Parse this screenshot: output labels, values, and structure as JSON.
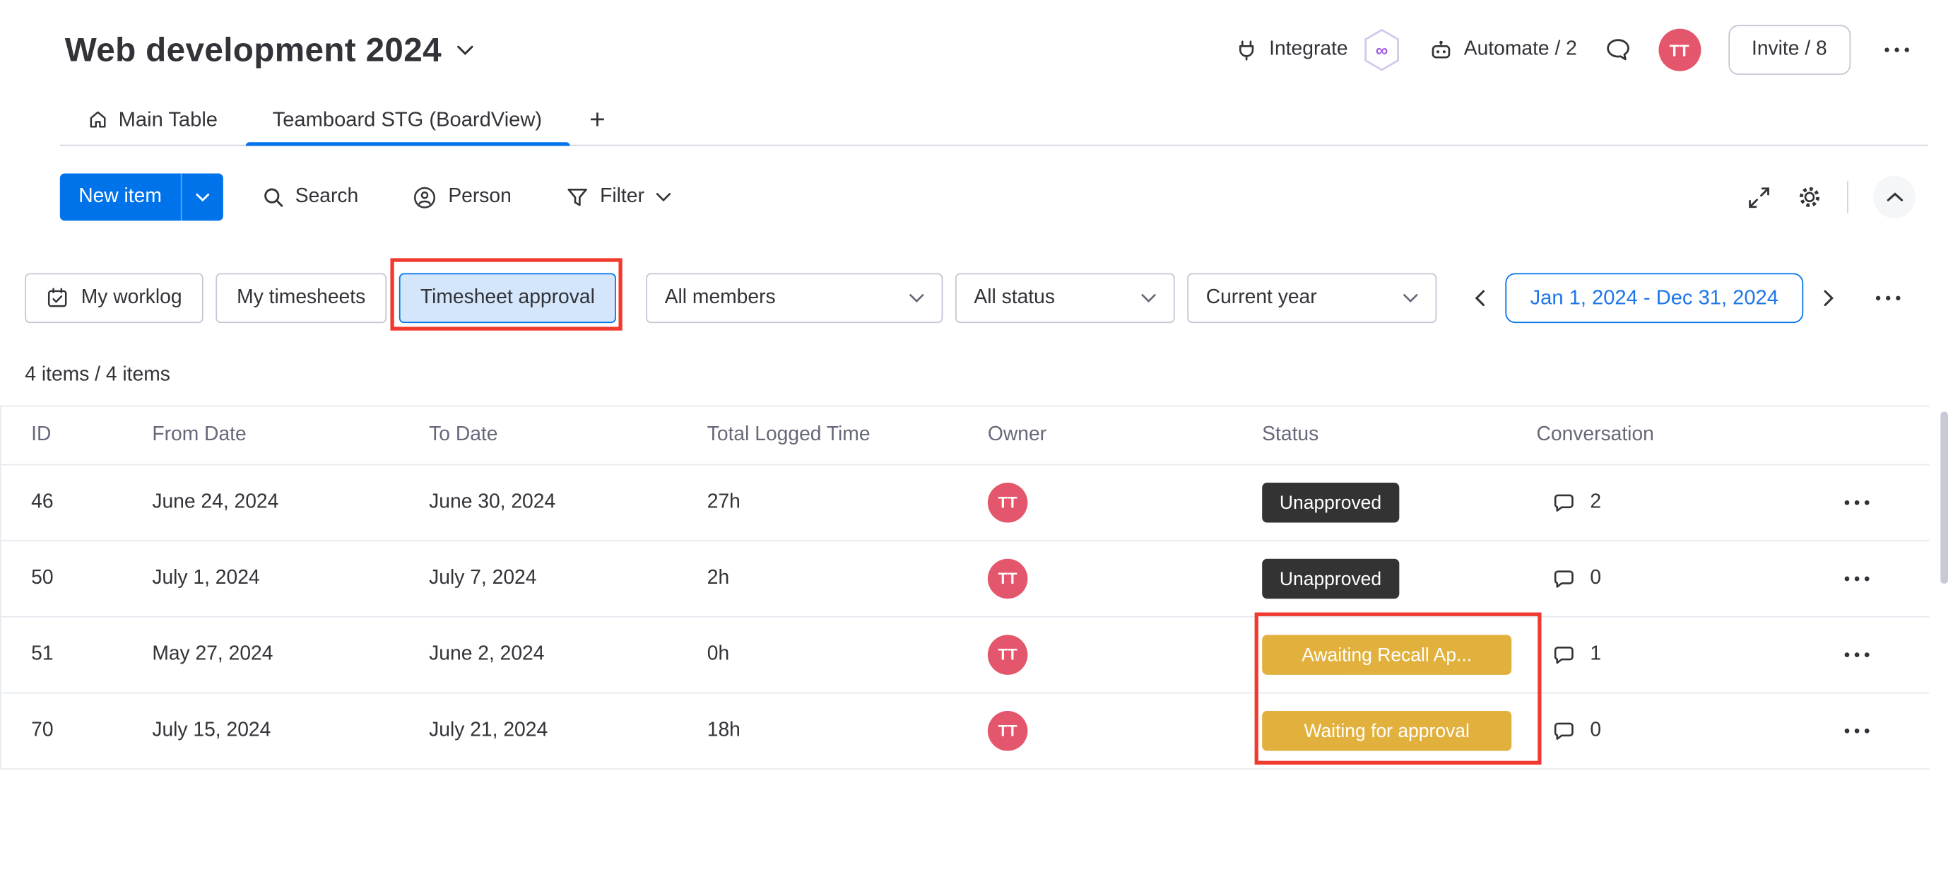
{
  "header": {
    "title": "Web development 2024",
    "integrate_label": "Integrate",
    "automate_label": "Automate / 2",
    "invite_label": "Invite / 8",
    "avatar_initials": "TT"
  },
  "icons": {
    "infinity": "∞"
  },
  "tabs": {
    "main": "Main Table",
    "board": "Teamboard STG (BoardView)",
    "add": "+"
  },
  "toolbar": {
    "new_item": "New item",
    "search": "Search",
    "person": "Person",
    "filter": "Filter"
  },
  "filters": {
    "my_worklog": "My worklog",
    "my_timesheets": "My timesheets",
    "timesheet_approval": "Timesheet approval",
    "all_members": "All members",
    "all_status": "All status",
    "period": "Current year",
    "date_range": "Jan 1, 2024 - Dec 31, 2024"
  },
  "summary": {
    "items_count": "4 items / 4 items"
  },
  "table": {
    "columns": [
      "ID",
      "From Date",
      "To Date",
      "Total Logged Time",
      "Owner",
      "Status",
      "Conversation"
    ],
    "rows": [
      {
        "id": "46",
        "from_date": "June 24, 2024",
        "to_date": "June 30, 2024",
        "total_logged": "27h",
        "owner_initials": "TT",
        "status": "Unapproved",
        "status_type": "dark",
        "conversation_count": "2"
      },
      {
        "id": "50",
        "from_date": "July 1, 2024",
        "to_date": "July 7, 2024",
        "total_logged": "2h",
        "owner_initials": "TT",
        "status": "Unapproved",
        "status_type": "dark",
        "conversation_count": "0"
      },
      {
        "id": "51",
        "from_date": "May 27, 2024",
        "to_date": "June 2, 2024",
        "total_logged": "0h",
        "owner_initials": "TT",
        "status": "Awaiting Recall Ap...",
        "status_type": "gold",
        "conversation_count": "1"
      },
      {
        "id": "70",
        "from_date": "July 15, 2024",
        "to_date": "July 21, 2024",
        "total_logged": "18h",
        "owner_initials": "TT",
        "status": "Waiting for approval",
        "status_type": "gold",
        "conversation_count": "0"
      }
    ]
  },
  "colors": {
    "accent": "#0073ea",
    "accent_text": "#1f76ea",
    "badge_dark": "#333333",
    "badge_gold": "#e2b13d",
    "avatar": "#e4566b",
    "annotation": "#f13a2f",
    "border": "#c3c6d4",
    "row_line": "#e6e9ef",
    "text": "#323338",
    "text_muted": "#676879"
  }
}
